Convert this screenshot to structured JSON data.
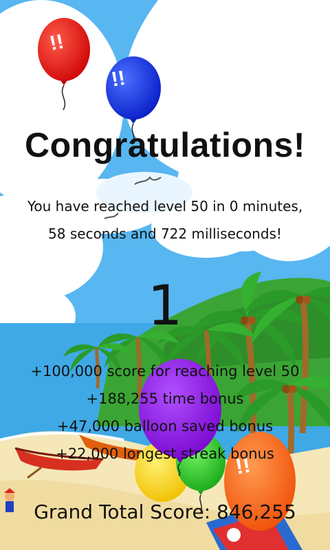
{
  "screen": {
    "title": "Congratulations!",
    "message_line1": "You have reached level 50 in 0 minutes,",
    "message_line2": "58 seconds and 722 milliseconds!",
    "counter": "1",
    "bonuses": [
      "+100,000 score for reaching level 50",
      "+188,255 time bonus",
      "+47,000 balloon saved bonus",
      "+22,000 longest streak bonus"
    ],
    "grand_total": "Grand Total Score: 846,255"
  },
  "balloon_marks": "!!",
  "colors": {
    "sky": "#58b6f0",
    "cloud": "#ffffff",
    "sand": "#f5e7b8",
    "sea": "#3fa9e6",
    "red_balloon": "#e81010",
    "blue_balloon": "#1030e0",
    "purple_balloon": "#9010e0",
    "yellow_balloon": "#f5d010",
    "green_balloon": "#28c020",
    "orange_balloon": "#ff6010"
  }
}
